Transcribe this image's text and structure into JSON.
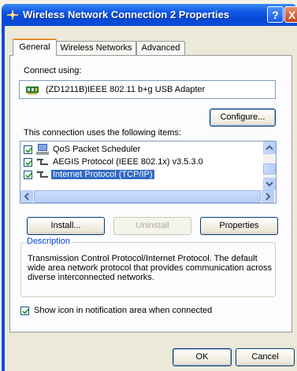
{
  "window": {
    "title": "Wireless Network Connection 2 Properties",
    "help_label": "?",
    "close_label": "X"
  },
  "tabs": [
    {
      "label": "General",
      "active": true
    },
    {
      "label": "Wireless Networks",
      "active": false
    },
    {
      "label": "Advanced",
      "active": false
    }
  ],
  "general": {
    "connect_using_label": "Connect using:",
    "adapter_name": "(ZD1211B)IEEE 802.11 b+g USB Adapter",
    "configure_label": "Configure...",
    "items_label": "This connection uses the following items:",
    "items": [
      {
        "label": "QoS Packet Scheduler",
        "checked": true,
        "icon": "scheduler-icon",
        "selected": false
      },
      {
        "label": "AEGIS Protocol (IEEE 802.1x) v3.5.3.0",
        "checked": true,
        "icon": "network-protocol-icon",
        "selected": false
      },
      {
        "label": "Internet Protocol (TCP/IP)",
        "checked": true,
        "icon": "network-protocol-icon",
        "selected": true
      }
    ],
    "install_label": "Install...",
    "uninstall_label": "Uninstall",
    "properties_label": "Properties",
    "description_title": "Description",
    "description_text": "Transmission Control Protocol/Internet Protocol. The default wide area network protocol that provides communication across diverse interconnected networks.",
    "show_icon_label": "Show icon in notification area when connected",
    "show_icon_checked": true
  },
  "footer": {
    "ok_label": "OK",
    "cancel_label": "Cancel"
  },
  "colors": {
    "titlebar": "#0548d5",
    "dialog_bg": "#ece9d8",
    "selection": "#316ac5",
    "tab_highlight": "#e68b2c",
    "groupbox_title": "#0046d5"
  }
}
